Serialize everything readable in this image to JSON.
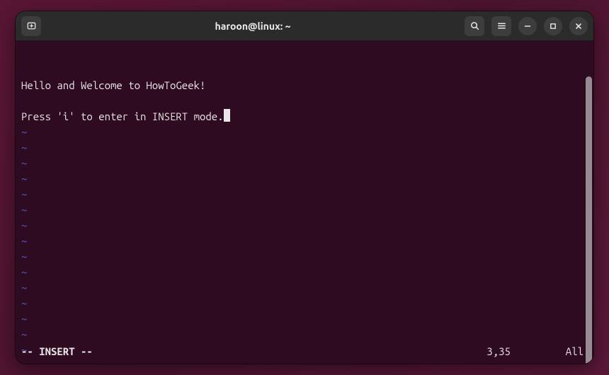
{
  "titlebar": {
    "title": "haroon@linux: ~"
  },
  "buffer": {
    "lines": [
      "Hello and Welcome to HowToGeek!",
      "",
      "Press 'i' to enter in INSERT mode."
    ],
    "tilde_count": 16,
    "tilde_char": "~"
  },
  "status": {
    "mode": "-- INSERT --",
    "position": "3,35",
    "percent": "All"
  }
}
